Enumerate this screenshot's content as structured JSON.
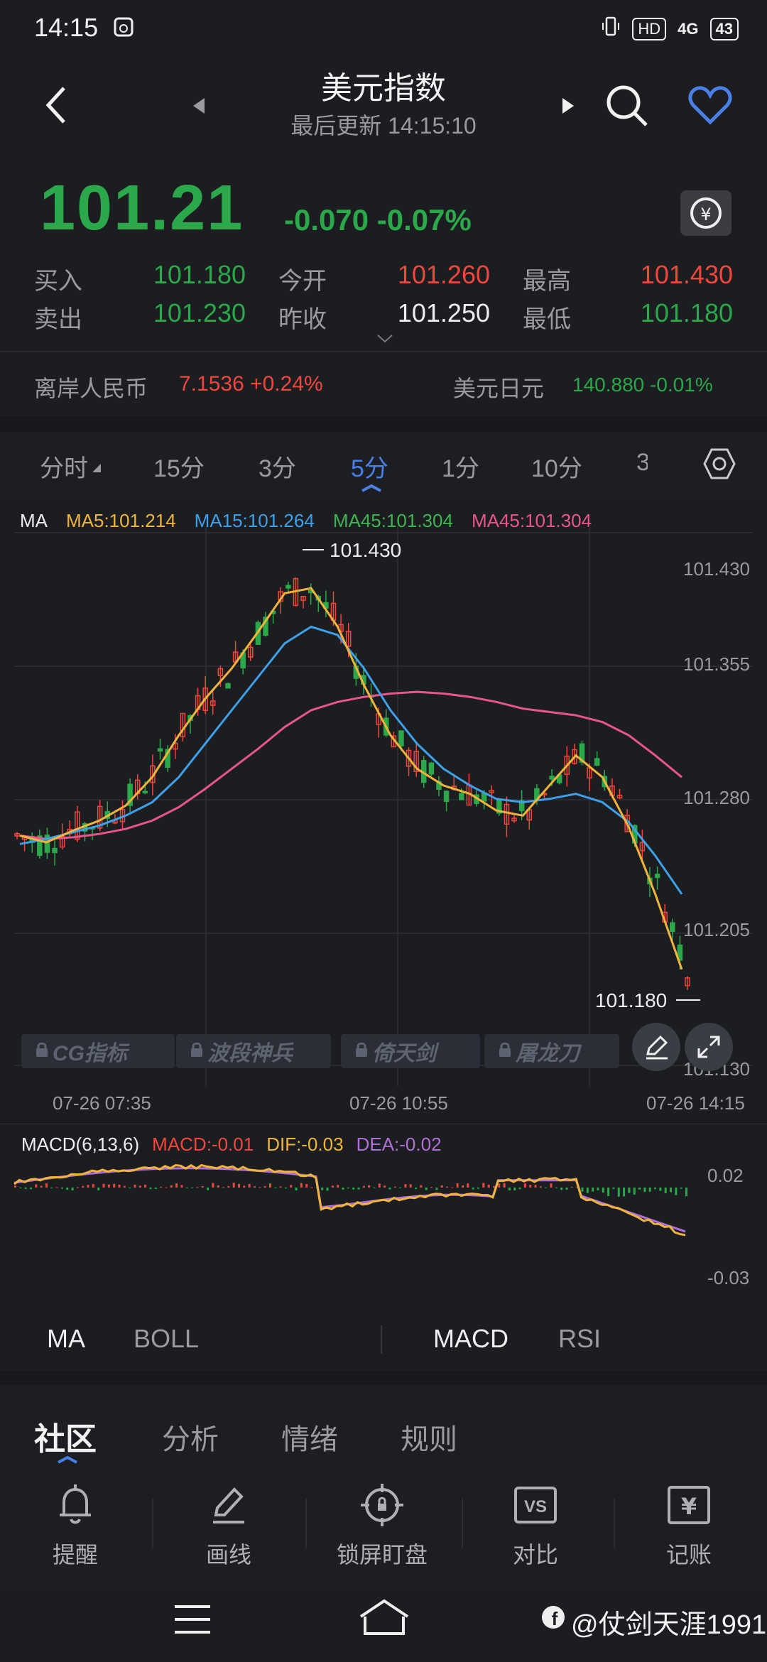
{
  "status": {
    "time": "14:15",
    "icons": [
      "vibrate-icon",
      "HD",
      "4G",
      "43"
    ]
  },
  "header": {
    "title": "美元指数",
    "subtitle": "最后更新 14:15:10"
  },
  "quote": {
    "price": "101.21",
    "change": "-0.070 -0.07%",
    "rows": [
      {
        "l1": "买入",
        "v1": "101.180",
        "l2": "今开",
        "v2": "101.260",
        "l3": "最高",
        "v3": "101.430"
      },
      {
        "l1": "卖出",
        "v1": "101.230",
        "l2": "昨收",
        "v2": "101.250",
        "l3": "最低",
        "v3": "101.180"
      }
    ]
  },
  "fx": {
    "left_label": "离岸人民币",
    "left_value": "7.1536 +0.24%",
    "right_label": "美元日元",
    "right_value": "140.880 -0.01%"
  },
  "periods": [
    "分时",
    "15分",
    "3分",
    "5分",
    "1分",
    "10分",
    "3"
  ],
  "active_period": "5分",
  "chart": {
    "ma_label": "MA",
    "ma5": "MA5:101.214",
    "ma15": "MA15:101.264",
    "ma45a": "MA45:101.304",
    "ma45b": "MA45:101.304",
    "high_mark": "101.430",
    "low_mark": "101.180",
    "yticks": [
      "101.430",
      "101.355",
      "101.280",
      "101.205",
      "101.130"
    ],
    "xticks": [
      "07-26 07:35",
      "07-26 10:55",
      "07-26 14:15"
    ],
    "tools": [
      "CG指标",
      "波段神兵",
      "倚天剑",
      "屠龙刀"
    ]
  },
  "macd": {
    "label": "MACD(6,13,6)",
    "macd": "MACD:-0.01",
    "dif": "DIF:-0.03",
    "dea": "DEA:-0.02",
    "ytop": "0.02",
    "ybot": "-0.03"
  },
  "indicator_tabs": {
    "main": [
      "MA",
      "BOLL"
    ],
    "sub": [
      "MACD",
      "RSI"
    ]
  },
  "community_tabs": [
    "社区",
    "分析",
    "情绪",
    "规则"
  ],
  "toolbar": [
    "提醒",
    "画线",
    "锁屏盯盘",
    "对比",
    "记账"
  ],
  "watermark": "@仗剑天涯1991",
  "chart_data": {
    "type": "candlestick",
    "y_range": [
      101.13,
      101.43
    ],
    "ma_series_shape": {
      "ma5_points": [
        101.27,
        101.266,
        101.273,
        101.279,
        101.288,
        101.305,
        101.33,
        101.352,
        101.37,
        101.392,
        101.415,
        101.418,
        101.395,
        101.36,
        101.33,
        101.31,
        101.3,
        101.295,
        101.285,
        101.282,
        101.3,
        101.318,
        101.305,
        101.275,
        101.235,
        101.19
      ],
      "ma15_points": [
        101.265,
        101.268,
        101.272,
        101.276,
        101.282,
        101.29,
        101.305,
        101.325,
        101.345,
        101.365,
        101.385,
        101.395,
        101.39,
        101.37,
        101.345,
        101.325,
        101.31,
        101.3,
        101.292,
        101.29,
        101.292,
        101.295,
        101.29,
        101.278,
        101.258,
        101.235
      ],
      "ma45_points": [
        101.27,
        101.268,
        101.269,
        101.271,
        101.274,
        101.279,
        101.287,
        101.298,
        101.31,
        101.322,
        101.335,
        101.345,
        101.35,
        101.353,
        101.355,
        101.356,
        101.355,
        101.353,
        101.35,
        101.346,
        101.344,
        101.342,
        101.338,
        101.33,
        101.318,
        101.305
      ]
    }
  }
}
